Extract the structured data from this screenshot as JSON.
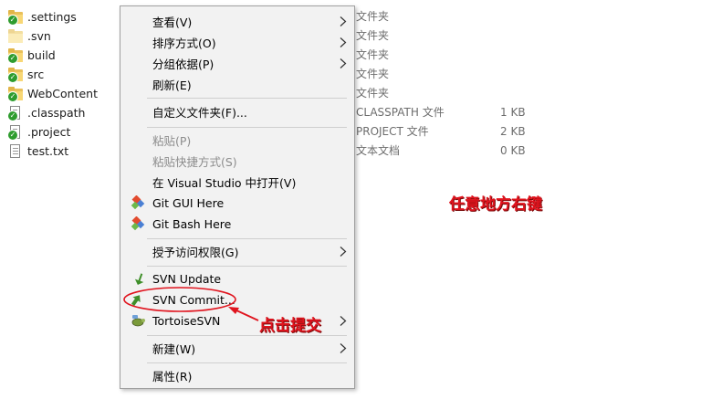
{
  "files": [
    {
      "name": ".settings",
      "icon": "folder-svn-icon"
    },
    {
      "name": ".svn",
      "icon": "folder-icon"
    },
    {
      "name": "build",
      "icon": "folder-svn-icon"
    },
    {
      "name": "src",
      "icon": "folder-svn-icon"
    },
    {
      "name": "WebContent",
      "icon": "folder-svn-icon"
    },
    {
      "name": ".classpath",
      "icon": "file-svn-icon"
    },
    {
      "name": ".project",
      "icon": "file-svn-icon"
    },
    {
      "name": "test.txt",
      "icon": "text-file-icon"
    }
  ],
  "columns": {
    "types": [
      "文件夹",
      "文件夹",
      "文件夹",
      "文件夹",
      "文件夹",
      "CLASSPATH 文件",
      "PROJECT 文件",
      "文本文档"
    ],
    "sizes": [
      "",
      "",
      "",
      "",
      "",
      "1 KB",
      "2 KB",
      "0 KB"
    ]
  },
  "menu": {
    "view": "查看(V)",
    "sort": "排序方式(O)",
    "group": "分组依据(P)",
    "refresh": "刷新(E)",
    "customize": "自定义文件夹(F)...",
    "paste": "粘贴(P)",
    "paste_shortcut": "粘贴快捷方式(S)",
    "open_vs": "在 Visual Studio 中打开(V)",
    "git_gui": "Git GUI Here",
    "git_bash": "Git Bash Here",
    "grant_access": "授予访问权限(G)",
    "svn_update": "SVN Update",
    "svn_commit": "SVN Commit...",
    "tortoise": "TortoiseSVN",
    "new": "新建(W)",
    "properties": "属性(R)"
  },
  "annotations": {
    "right_click": "任意地方右键",
    "click_commit": "点击提交"
  },
  "colors": {
    "annotation": "#e0141e",
    "svn_badge": "#2e9c2e",
    "folder": "#f8d775"
  }
}
